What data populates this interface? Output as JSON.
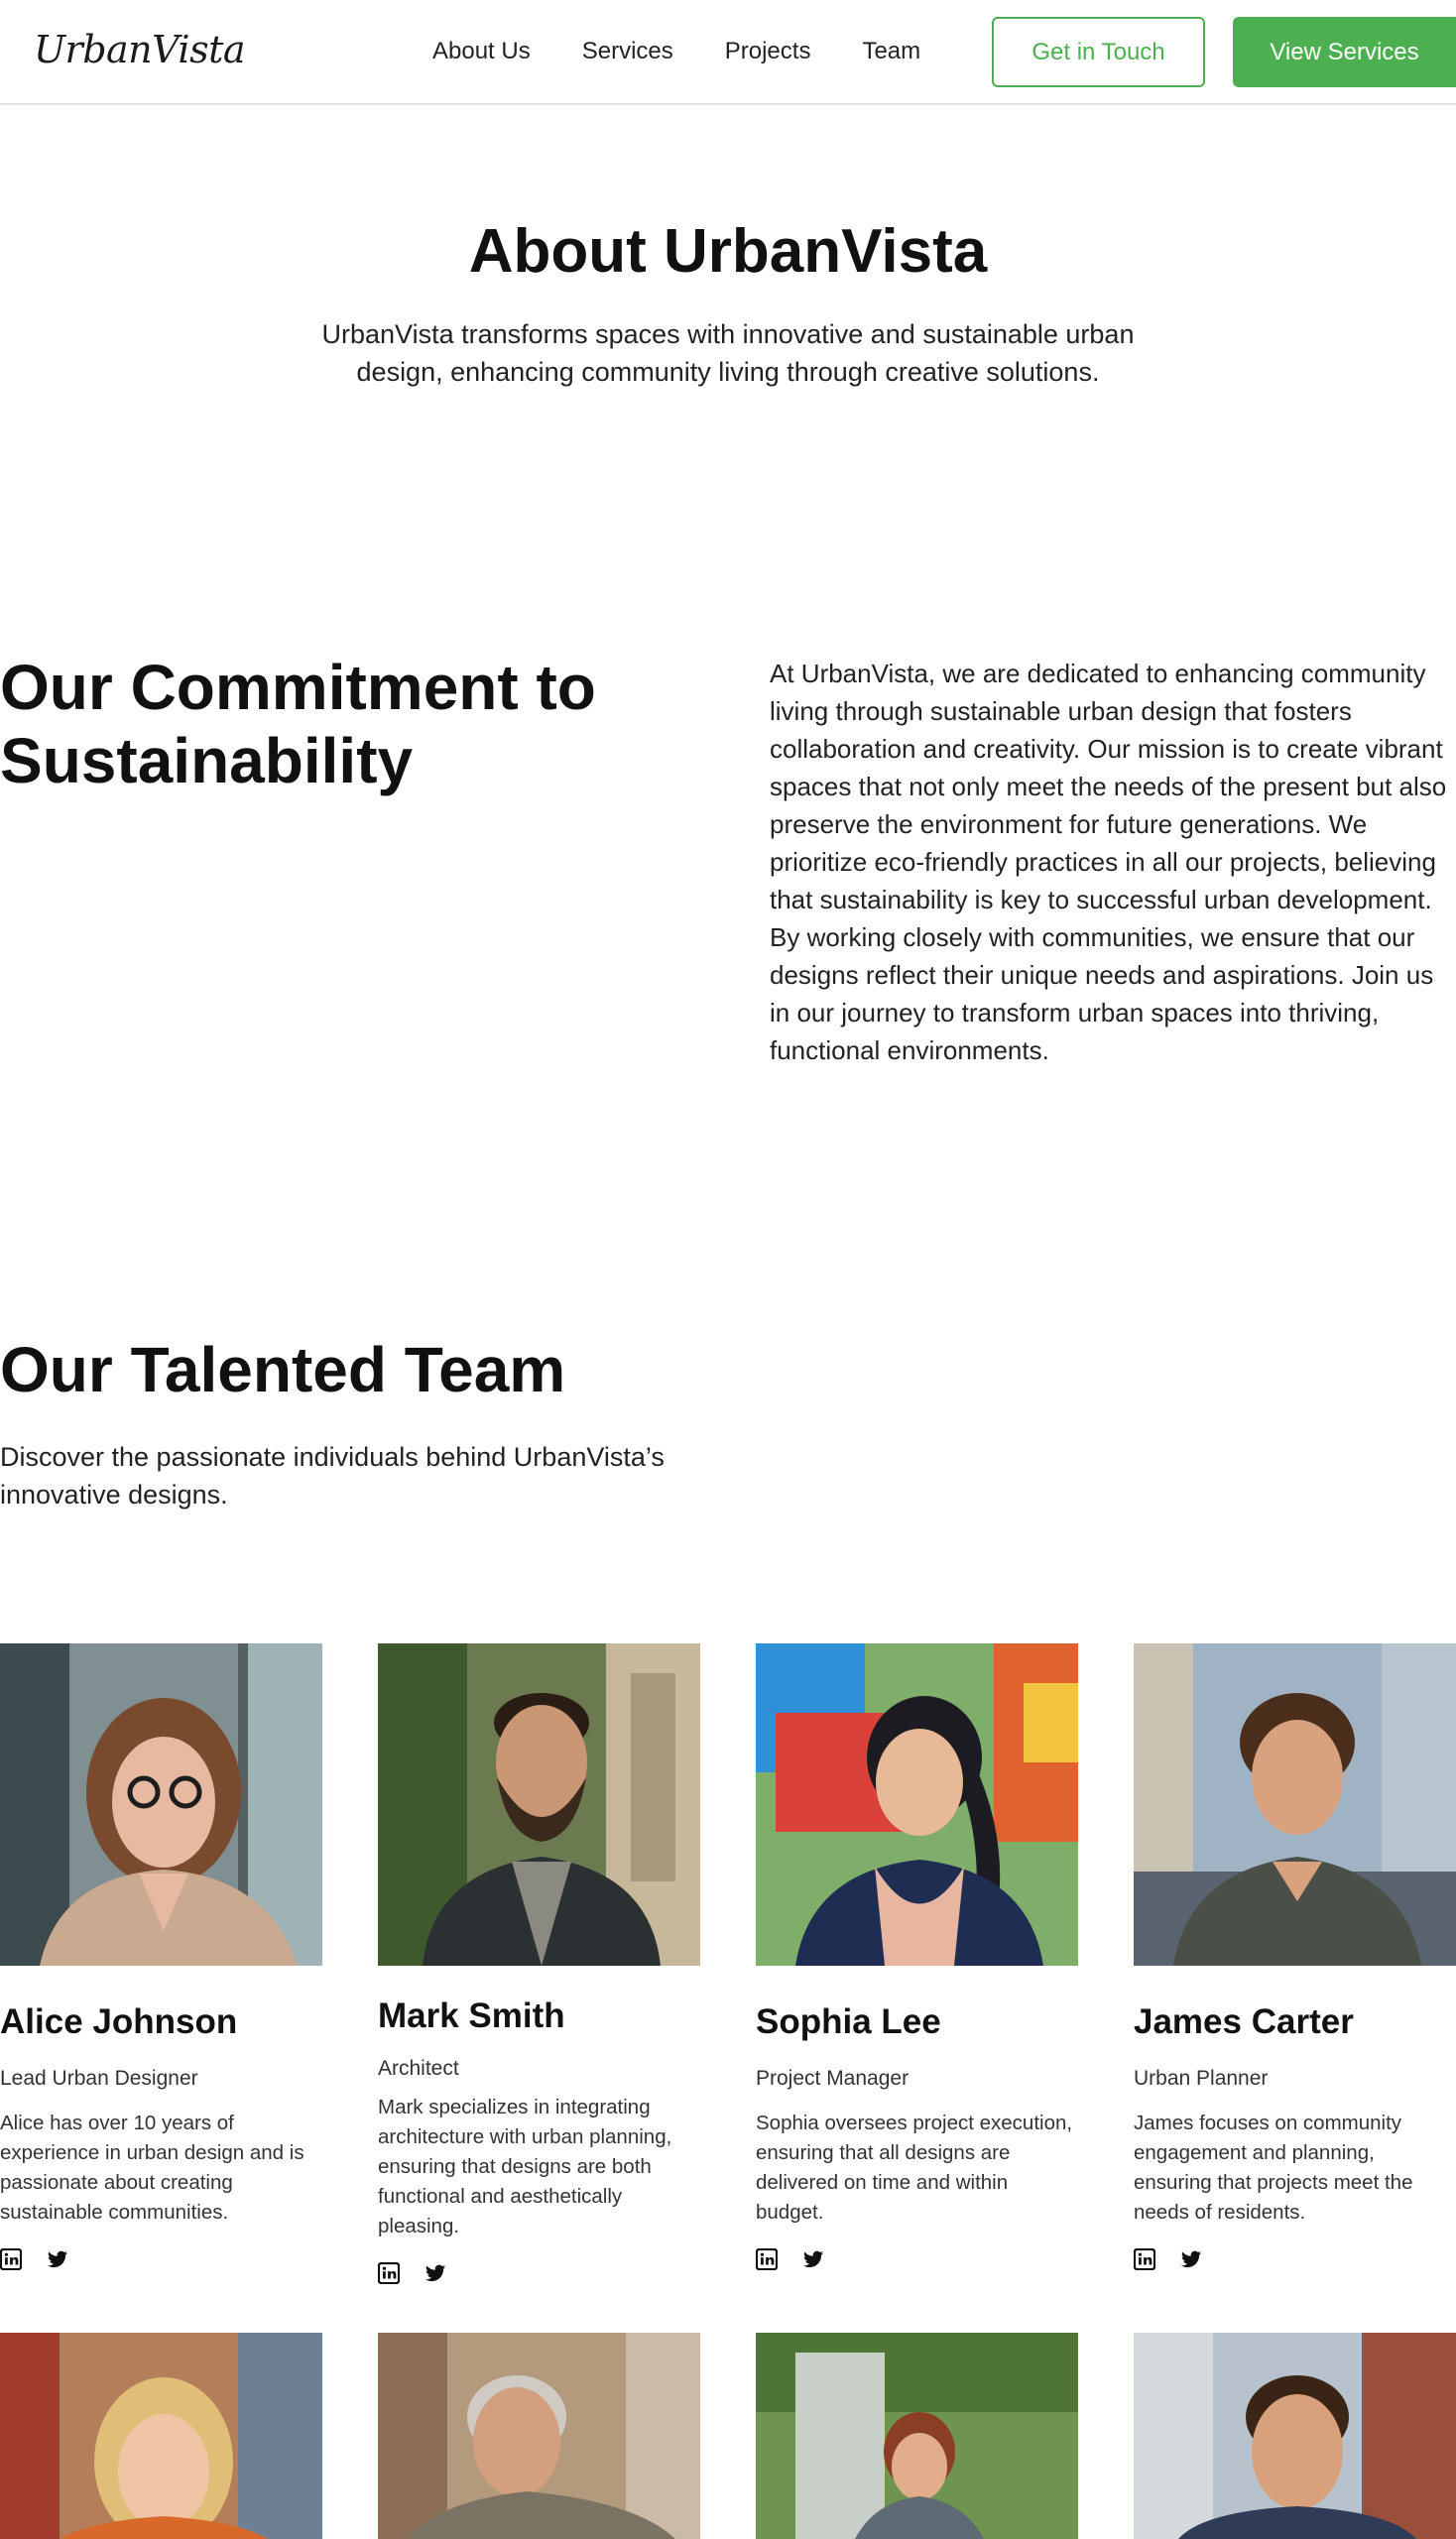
{
  "header": {
    "logo": "UrbanVista",
    "nav": [
      "About Us",
      "Services",
      "Projects",
      "Team"
    ],
    "cta_outline": "Get in Touch",
    "cta_solid": "View Services"
  },
  "about": {
    "title": "About UrbanVista",
    "text": "UrbanVista transforms spaces with innovative and sustainable urban design, enhancing community living through creative solutions."
  },
  "commitment": {
    "title": "Our Commitment to Sustainability",
    "text": "At UrbanVista, we are dedicated to enhancing community living through sustainable urban design that fosters collaboration and creativity. Our mission is to create vibrant spaces that not only meet the needs of the present but also preserve the environment for future generations. We prioritize eco-friendly practices in all our projects, believing that sustainability is key to successful urban development. By working closely with communities, we ensure that our designs reflect their unique needs and aspirations. Join us in our journey to transform urban spaces into thriving, functional environments."
  },
  "team": {
    "title": "Our Talented Team",
    "subtitle": "Discover the passionate individuals behind UrbanVista’s innovative designs.",
    "members": [
      {
        "name": "Alice Johnson",
        "role": "Lead Urban Designer",
        "bio": "Alice has over 10 years of experience in urban design and is passionate about creating sustainable communities."
      },
      {
        "name": "Mark Smith",
        "role": "Architect",
        "bio": "Mark specializes in integrating architecture with urban planning, ensuring that designs are both functional and aesthetically pleasing."
      },
      {
        "name": "Sophia Lee",
        "role": "Project Manager",
        "bio": "Sophia oversees project execution, ensuring that all designs are delivered on time and within budget."
      },
      {
        "name": "James Carter",
        "role": "Urban Planner",
        "bio": "James focuses on community engagement and planning, ensuring that projects meet the needs of residents."
      }
    ]
  },
  "icons": {
    "linkedin": "linkedin-icon",
    "twitter": "twitter-icon"
  },
  "colors": {
    "accent": "#4caf50",
    "text": "#1a1a1a",
    "border": "#e2e2e2"
  }
}
